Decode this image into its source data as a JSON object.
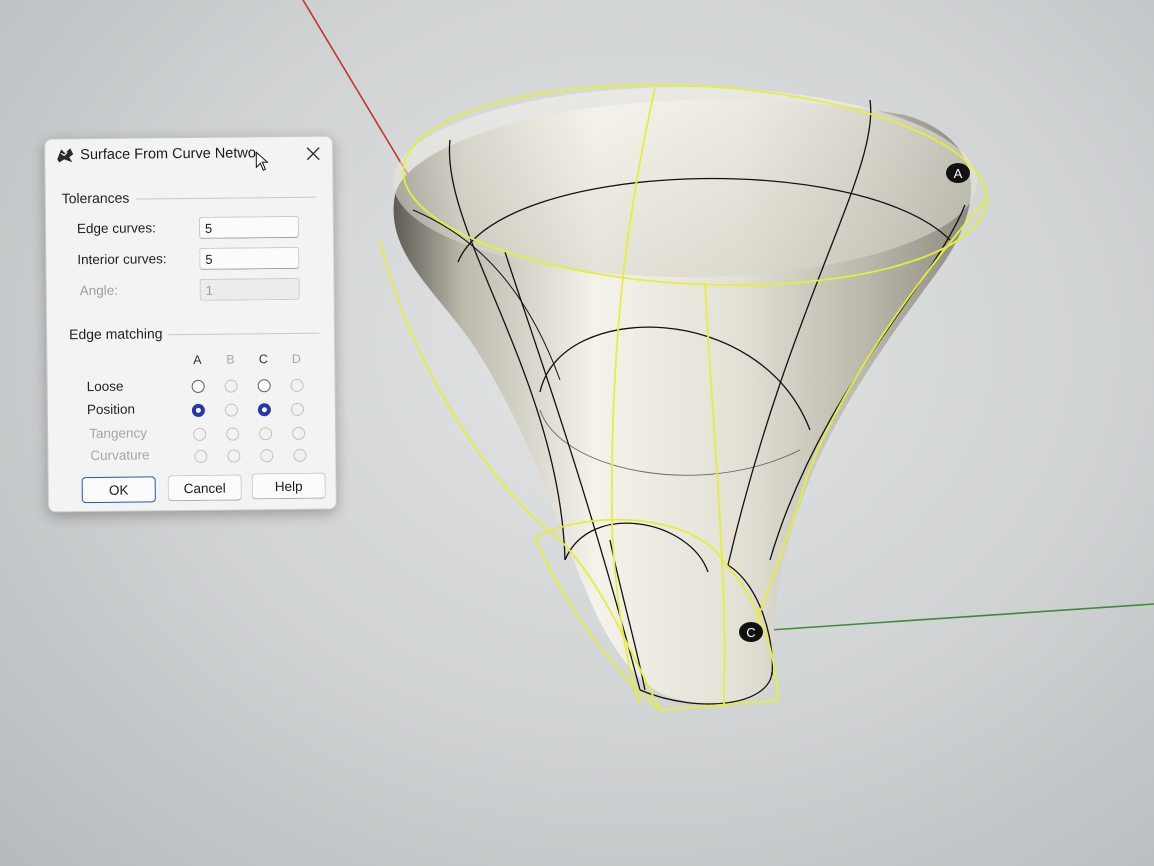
{
  "dialog": {
    "title": "Surface From Curve Netwo",
    "icon": "rhino-icon",
    "tolerances": {
      "label": "Tolerances",
      "edge_curves": {
        "label": "Edge curves:",
        "value": "5"
      },
      "interior_curves": {
        "label": "Interior curves:",
        "value": "5"
      },
      "angle": {
        "label": "Angle:",
        "value": "1",
        "disabled": true
      }
    },
    "edge_matching": {
      "label": "Edge matching",
      "columns": [
        "A",
        "B",
        "C",
        "D"
      ],
      "rows": [
        {
          "label": "Loose",
          "disabled": false
        },
        {
          "label": "Position",
          "disabled": false
        },
        {
          "label": "Tangency",
          "disabled": true
        },
        {
          "label": "Curvature",
          "disabled": true
        }
      ],
      "selected": {
        "A": "Position",
        "C": "Position"
      },
      "enabled_columns": [
        "A",
        "C"
      ]
    },
    "buttons": {
      "ok": "OK",
      "cancel": "Cancel",
      "help": "Help"
    }
  },
  "viewport": {
    "markers": {
      "a": "A",
      "c": "C"
    },
    "colors": {
      "curve_highlight": "#e6ee3a",
      "curve_network": "#111111",
      "x_axis": "#c2332d",
      "y_axis": "#3f8a3c",
      "marker_fill": "#111111"
    }
  }
}
